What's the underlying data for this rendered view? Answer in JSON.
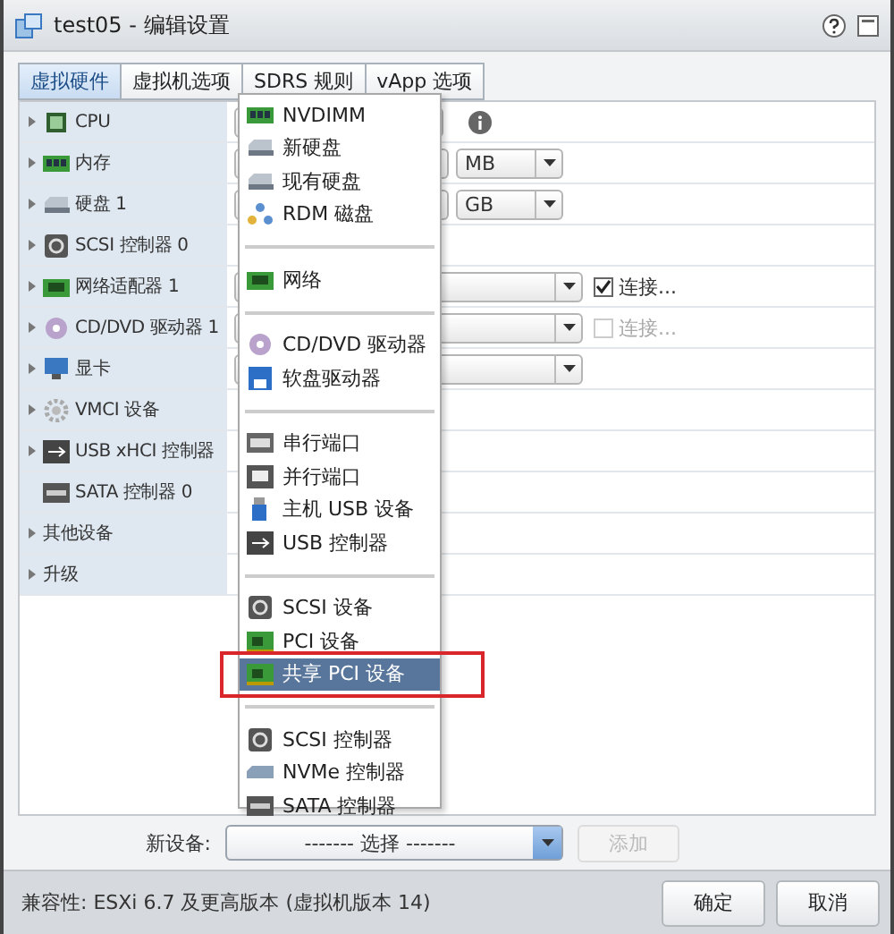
{
  "window": {
    "title": "test05 - 编辑设置"
  },
  "tabs": [
    {
      "label": "虚拟硬件",
      "selected": true
    },
    {
      "label": "虚拟机选项",
      "selected": false
    },
    {
      "label": "SDRS 规则",
      "selected": false
    },
    {
      "label": "vApp 选项",
      "selected": false
    }
  ],
  "hardware": [
    {
      "label": "CPU",
      "kind": "cpu",
      "expandable": true,
      "control": {
        "kind": "field"
      },
      "info": true
    },
    {
      "label": "内存",
      "kind": "memory",
      "expandable": true,
      "control": {
        "kind": "field"
      },
      "unit": "MB"
    },
    {
      "label": "硬盘 1",
      "kind": "disk",
      "expandable": true,
      "control": {
        "kind": "field"
      },
      "unit": "GB"
    },
    {
      "label": "SCSI 控制器 0",
      "kind": "scsi",
      "expandable": true,
      "control": {
        "kind": "none"
      }
    },
    {
      "label": "网络适配器 1",
      "kind": "network",
      "expandable": true,
      "control": {
        "kind": "select"
      },
      "connect": {
        "label": "连接...",
        "checked": true,
        "disabled": false
      }
    },
    {
      "label": "CD/DVD 驱动器 1",
      "kind": "disc",
      "expandable": true,
      "control": {
        "kind": "select"
      },
      "connect": {
        "label": "连接...",
        "checked": false,
        "disabled": true
      }
    },
    {
      "label": "显卡",
      "kind": "display",
      "expandable": true,
      "control": {
        "kind": "select"
      }
    },
    {
      "label": "VMCI 设备",
      "kind": "vmci",
      "expandable": true,
      "control": {
        "kind": "none"
      }
    },
    {
      "label": "USB xHCI 控制器",
      "kind": "usb",
      "expandable": true,
      "control": {
        "kind": "none"
      }
    },
    {
      "label": "SATA 控制器 0",
      "kind": "sata",
      "expandable": false,
      "control": {
        "kind": "none"
      }
    },
    {
      "label": "其他设备",
      "kind": "none",
      "expandable": true,
      "control": {
        "kind": "none"
      }
    },
    {
      "label": "升级",
      "kind": "none",
      "expandable": true,
      "control": {
        "kind": "none"
      }
    }
  ],
  "menu": {
    "items": [
      {
        "kind": "memory",
        "label": "NVDIMM",
        "selected": false
      },
      {
        "kind": "disk",
        "label": "新硬盘",
        "selected": false
      },
      {
        "kind": "disk",
        "label": "现有硬盘",
        "selected": false
      },
      {
        "kind": "rdm",
        "label": "RDM 磁盘",
        "selected": false
      },
      {
        "kind": "separator"
      },
      {
        "kind": "network",
        "label": "网络",
        "selected": false
      },
      {
        "kind": "separator"
      },
      {
        "kind": "disc",
        "label": "CD/DVD 驱动器",
        "selected": false
      },
      {
        "kind": "floppy",
        "label": "软盘驱动器",
        "selected": false
      },
      {
        "kind": "separator"
      },
      {
        "kind": "serial",
        "label": "串行端口",
        "selected": false
      },
      {
        "kind": "parallel",
        "label": "并行端口",
        "selected": false
      },
      {
        "kind": "usbdev",
        "label": "主机 USB 设备",
        "selected": false
      },
      {
        "kind": "usb",
        "label": "USB 控制器",
        "selected": false
      },
      {
        "kind": "separator"
      },
      {
        "kind": "scsi",
        "label": "SCSI 设备",
        "selected": false
      },
      {
        "kind": "pci",
        "label": "PCI 设备",
        "selected": false
      },
      {
        "kind": "pci",
        "label": "共享 PCI 设备",
        "selected": true
      },
      {
        "kind": "separator"
      },
      {
        "kind": "scsi",
        "label": "SCSI 控制器",
        "selected": false
      },
      {
        "kind": "nvme",
        "label": "NVMe 控制器",
        "selected": false
      },
      {
        "kind": "sata",
        "label": "SATA 控制器",
        "selected": false
      }
    ]
  },
  "new_device": {
    "label": "新设备:",
    "select": "------- 选择 -------",
    "add_button": {
      "label": "添加",
      "disabled": true
    }
  },
  "status_bar": {
    "compatibility": "兼容性: ESXi 6.7 及更高版本 (虚拟机版本 14)"
  },
  "buttons": [
    "确定",
    "取消"
  ]
}
